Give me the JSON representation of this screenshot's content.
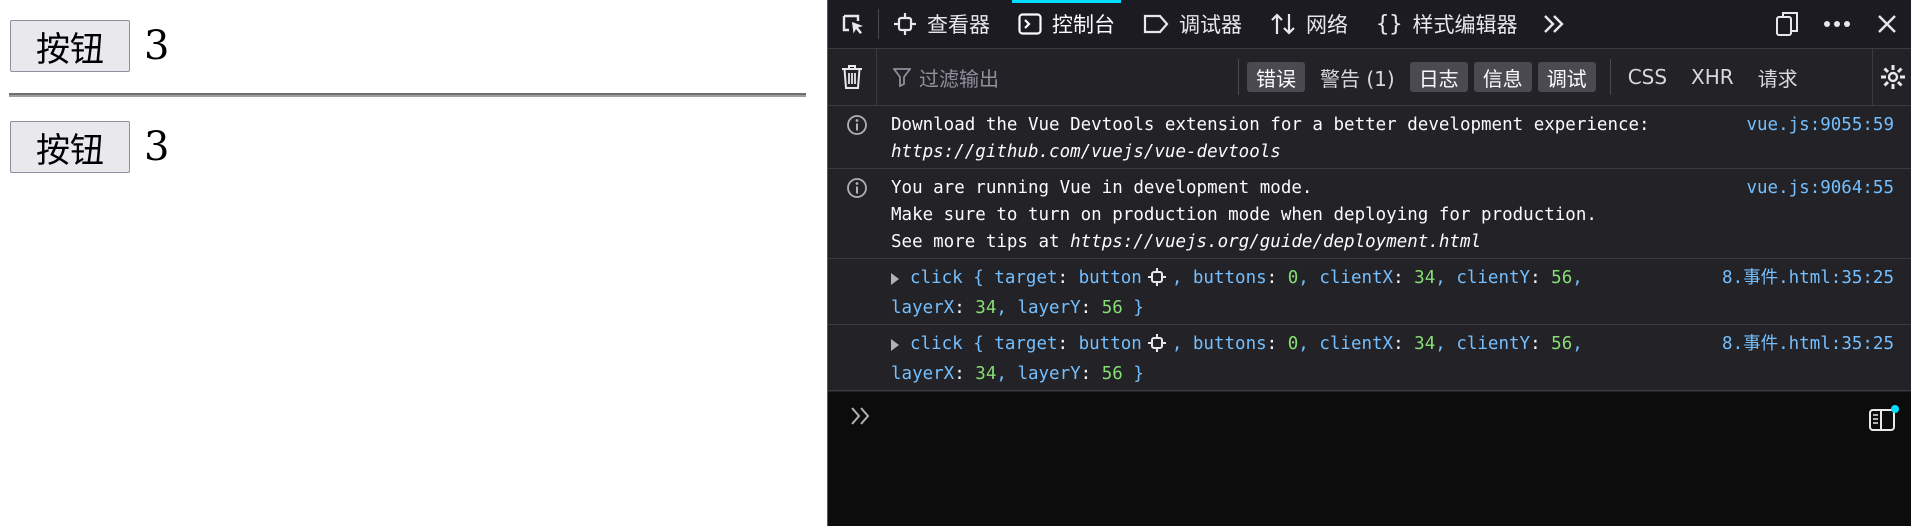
{
  "page": {
    "row1": {
      "button_label": "按钮",
      "count": "3"
    },
    "row2": {
      "button_label": "按钮",
      "count": "3"
    }
  },
  "devtools": {
    "tabs": [
      {
        "label": "查看器",
        "icon": "inspector-icon"
      },
      {
        "label": "控制台",
        "icon": "console-icon",
        "active": true
      },
      {
        "label": "调试器",
        "icon": "debugger-icon"
      },
      {
        "label": "网络",
        "icon": "network-icon"
      },
      {
        "label": "样式编辑器",
        "icon": "style-editor-icon"
      }
    ],
    "filter": {
      "placeholder": "过滤输出",
      "levels": [
        {
          "label": "错误",
          "on": true
        },
        {
          "label": "警告 (1)",
          "on": false
        },
        {
          "label": "日志",
          "on": true
        },
        {
          "label": "信息",
          "on": true
        },
        {
          "label": "调试",
          "on": true
        }
      ],
      "types": [
        "CSS",
        "XHR",
        "请求"
      ]
    },
    "messages": [
      {
        "line1": "Download the Vue Devtools extension for a better development experience:",
        "line2": "https://github.com/vuejs/vue-devtools",
        "location": "vue.js:9055:59"
      },
      {
        "line1": "You are running Vue in development mode.",
        "line2": "Make sure to turn on production mode when deploying for production.",
        "line3_prefix": "See more tips at ",
        "line3_link": "https://vuejs.org/guide/deployment.html",
        "location": "vue.js:9064:55"
      },
      {
        "event": "click",
        "target": "button",
        "buttons": "0",
        "clientX": "34",
        "clientY": "56",
        "layerX": "34",
        "layerY": "56",
        "location": "8.事件.html:35:25"
      },
      {
        "event": "click",
        "target": "button",
        "buttons": "0",
        "clientX": "34",
        "clientY": "56",
        "layerX": "34",
        "layerY": "56",
        "location": "8.事件.html:35:25"
      }
    ],
    "colors": {
      "accent": "#00ddff",
      "link": "#75bfff",
      "number": "#86de74",
      "background": "#232327"
    }
  }
}
